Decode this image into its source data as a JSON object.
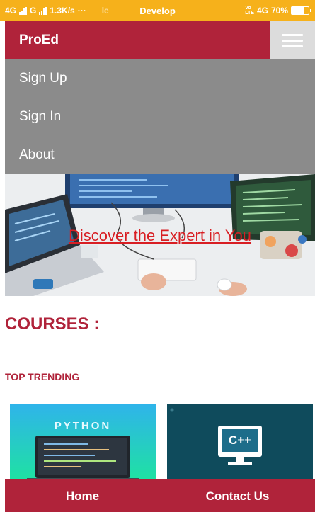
{
  "status_bar": {
    "network1": "4G",
    "network2": "G",
    "speed": "1.3K/s",
    "dots": "···",
    "faded": "le",
    "center": "Develop",
    "right_network": "4G",
    "battery_percent": "70%",
    "battery_level": 0.7
  },
  "navbar": {
    "brand": "ProEd"
  },
  "menu": {
    "items": [
      {
        "label": "Sign Up"
      },
      {
        "label": "Sign In"
      },
      {
        "label": "About"
      }
    ]
  },
  "hero": {
    "text": "Discover the Expert in You"
  },
  "courses": {
    "heading": "COURSES :",
    "subheading": "TOP TRENDING",
    "cards": [
      {
        "label": "PYTHON",
        "icon": "laptop-icon"
      },
      {
        "label": "C++",
        "icon": "monitor-icon"
      }
    ]
  },
  "bottom_nav": {
    "home": "Home",
    "contact": "Contact Us"
  },
  "colors": {
    "status_bar": "#f6b11b",
    "brand": "#b0233a",
    "menu": "#8b8b8b",
    "hero_link": "#d81e23"
  }
}
